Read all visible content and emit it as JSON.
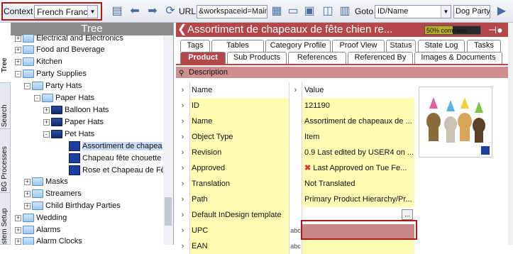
{
  "toolbar": {
    "context_label": "Context",
    "context_value": "French France",
    "url_label": "URL",
    "url_value": "&workspaceid=Main",
    "goto_label": "Goto",
    "goto_select_value": "ID/Name",
    "goto_input_value": "Dog Party"
  },
  "side_tabs": [
    "Tree",
    "Search",
    "BG Processes",
    "stem Setup"
  ],
  "tree": {
    "header": "Tree",
    "items": [
      {
        "label": "Electrical and Electronics",
        "expander": "+"
      },
      {
        "label": "Food and Beverage",
        "expander": "+"
      },
      {
        "label": "Kitchen",
        "expander": "+"
      },
      {
        "label": "Party Supplies",
        "expander": "-"
      },
      {
        "label": "Party Hats",
        "expander": "-"
      },
      {
        "label": "Paper Hats",
        "expander": "-"
      },
      {
        "label": "Balloon Hats",
        "expander": "+"
      },
      {
        "label": "Paper Hats",
        "expander": "+"
      },
      {
        "label": "Pet Hats",
        "expander": "-"
      },
      {
        "label": "Assortiment de chapea",
        "expander": ""
      },
      {
        "label": "Chapeau fête chouette",
        "expander": ""
      },
      {
        "label": "Rose et Chapeau de Fê",
        "expander": ""
      },
      {
        "label": "Masks",
        "expander": "+"
      },
      {
        "label": "Streamers",
        "expander": "+"
      },
      {
        "label": "Child Birthday Parties",
        "expander": "+"
      },
      {
        "label": "Wedding",
        "expander": "+"
      },
      {
        "label": "Alarms",
        "expander": "+"
      },
      {
        "label": "Alarm Clocks",
        "expander": "+"
      }
    ]
  },
  "detail": {
    "title": "Assortiment de chapeaux de fête chien re...",
    "progress_text": "50% complete",
    "progress_value": 0.5,
    "tabs_row1": [
      "Tags",
      "Tables",
      "Category Profile",
      "Proof View",
      "Status",
      "State Log",
      "Tasks"
    ],
    "tabs_row2": [
      "Product",
      "Sub Products",
      "References",
      "Referenced By",
      "Images & Documents"
    ],
    "section_label": "Description",
    "grid_headers": {
      "name": "Name",
      "value": "Value"
    },
    "rows": [
      {
        "name": "ID",
        "value": "121190"
      },
      {
        "name": "Name",
        "value": "Assortiment de chapeaux de ..."
      },
      {
        "name": "Object Type",
        "value": "Item"
      },
      {
        "name": "Revision",
        "value": "0.9 Last edited by USER4 on ..."
      },
      {
        "name": "Approved",
        "value": "Last Approved on Tue Fe..."
      },
      {
        "name": "Translation",
        "value": "Not Translated"
      },
      {
        "name": "Path",
        "value": "Primary Product Hierarchy/Pr..."
      },
      {
        "name": "Default InDesign template",
        "value": ""
      },
      {
        "name": "UPC",
        "value": ""
      },
      {
        "name": "EAN",
        "value": ""
      }
    ]
  }
}
